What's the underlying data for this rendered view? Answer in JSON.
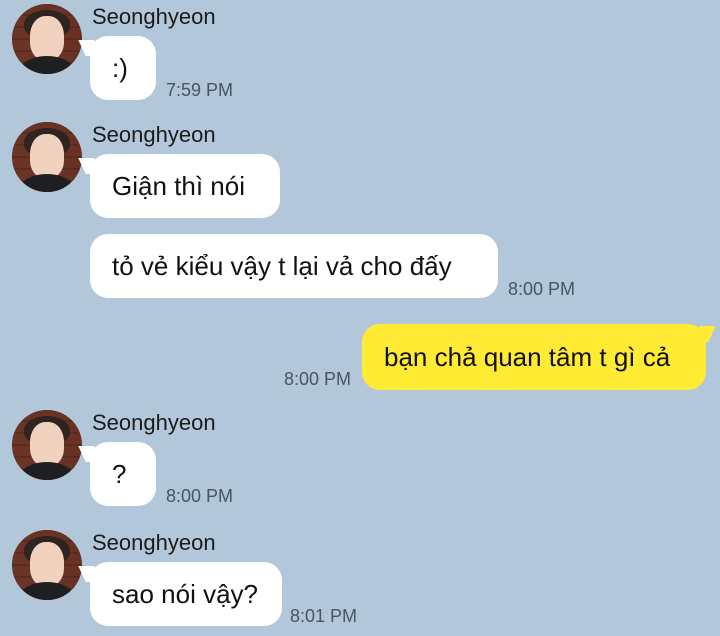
{
  "colors": {
    "background": "#b2c7da",
    "incoming_bubble": "#ffffff",
    "outgoing_bubble": "#ffeb33",
    "time_text": "#4a5560"
  },
  "messages": [
    {
      "sender": "Seonghyeon",
      "avatar_icon": "profile-photo",
      "bubbles": [
        {
          "text": ":)"
        }
      ],
      "time": "7:59 PM"
    },
    {
      "sender": "Seonghyeon",
      "avatar_icon": "profile-photo",
      "bubbles": [
        {
          "text": "Giận thì nói"
        },
        {
          "text": "tỏ vẻ kiểu vậy t lại vả cho đấy"
        }
      ],
      "time": "8:00 PM"
    },
    {
      "sender": "me",
      "bubbles": [
        {
          "text": "bạn chả quan tâm t gì cả"
        }
      ],
      "time": "8:00 PM"
    },
    {
      "sender": "Seonghyeon",
      "avatar_icon": "profile-photo",
      "bubbles": [
        {
          "text": "?"
        }
      ],
      "time": "8:00 PM"
    },
    {
      "sender": "Seonghyeon",
      "avatar_icon": "profile-photo",
      "bubbles": [
        {
          "text": "sao nói vậy?"
        }
      ],
      "time": "8:01 PM"
    }
  ]
}
